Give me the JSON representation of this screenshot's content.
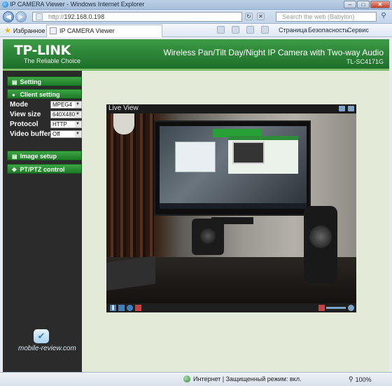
{
  "window": {
    "title": "IP CAMERA Viewer - Windows Internet Explorer"
  },
  "address": {
    "url_prefix": "http://",
    "url": "192.168.0.198",
    "search_placeholder": "Search the web (Babylon)"
  },
  "favorites": {
    "label": "Избранное",
    "tab_label": "IP CAMERA Viewer"
  },
  "commands": {
    "page": "Страница",
    "security": "Безопасность",
    "service": "Сервис"
  },
  "header": {
    "logo": "TP-LINK",
    "tagline": "The Reliable Choice",
    "camera_title": "Wireless Pan/Tilt Day/Night IP Camera with Two-way Audio",
    "model": "TL-SC4171G"
  },
  "sidebar": {
    "setting": "Setting",
    "client_setting": "Client setting",
    "fields": [
      {
        "label": "Mode",
        "value": "MPEG4"
      },
      {
        "label": "View size",
        "value": "640X480"
      },
      {
        "label": "Protocol",
        "value": "HTTP"
      },
      {
        "label": "Video buffer",
        "value": "Off"
      }
    ],
    "image_setup": "Image setup",
    "ptz_control": "PT/PTZ control",
    "watermark": "mobile-review.com"
  },
  "viewer": {
    "title": "Live View"
  },
  "status": {
    "zone": "Интернет | Защищенный режим: вкл.",
    "zoom": "100%"
  },
  "colors": {
    "brand_green": "#1d6e29",
    "accent": "#3da644",
    "sidebar_bg": "#2b2b2b"
  }
}
